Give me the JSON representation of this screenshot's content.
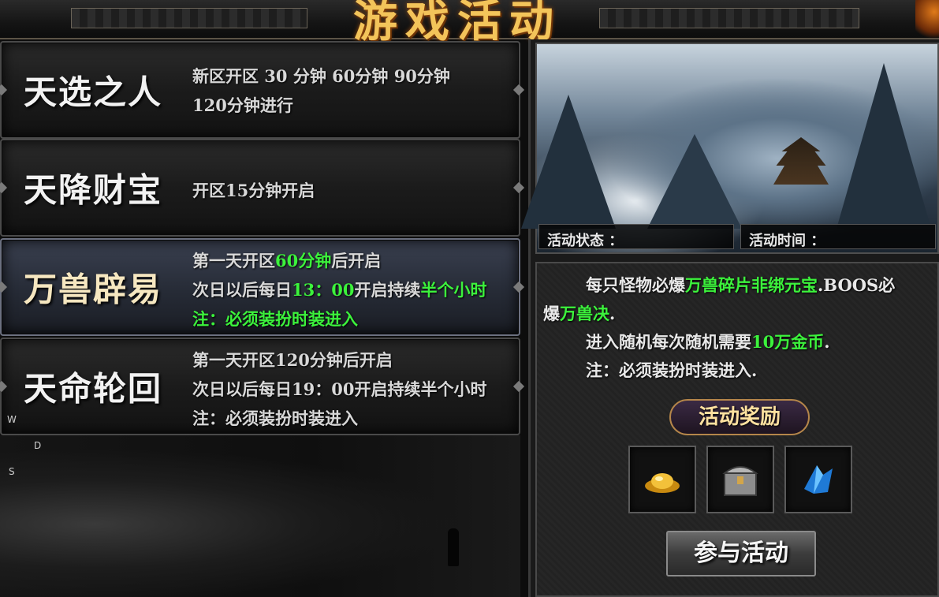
{
  "header": {
    "title": "游戏活动"
  },
  "events": [
    {
      "name": "天选之人",
      "lines": [
        [
          {
            "t": "新区开区 30 分钟    60分钟   90分钟",
            "c": "w"
          }
        ],
        [
          {
            "t": "120分钟进行",
            "c": "w"
          }
        ]
      ]
    },
    {
      "name": "天降财宝",
      "lines": [
        [
          {
            "t": "开区15分钟开启",
            "c": "w"
          }
        ]
      ]
    },
    {
      "name": "万兽辟易",
      "lines": [
        [
          {
            "t": "第一天开区",
            "c": "w"
          },
          {
            "t": "60分钟",
            "c": "g"
          },
          {
            "t": "后开启",
            "c": "w"
          }
        ],
        [
          {
            "t": "次日以后每日",
            "c": "w"
          },
          {
            "t": "13：00",
            "c": "g"
          },
          {
            "t": "开启持续",
            "c": "w"
          },
          {
            "t": "半个小时",
            "c": "g"
          }
        ],
        [
          {
            "t": "注：必须装扮时装进入",
            "c": "g"
          }
        ]
      ]
    },
    {
      "name": "天命轮回",
      "lines": [
        [
          {
            "t": "第一天开区120分钟后开启",
            "c": "w"
          }
        ],
        [
          {
            "t": "次日以后每日19：00开启持续半个小时",
            "c": "w"
          }
        ],
        [
          {
            "t": "注：必须装扮时装进入",
            "c": "w"
          }
        ]
      ]
    }
  ],
  "scene": {
    "status_label": "活动状态 ：",
    "time_label": "活动时间 ："
  },
  "info": {
    "line1a": "每只怪物必爆",
    "line1b": "万兽碎片非绑元宝",
    "line1c": ".BOOS必",
    "line2a": "爆",
    "line2b": "万兽决",
    "line2c": ".",
    "line3a": "进入随机每次随机需要",
    "line3b": "10万金币",
    "line3c": ".",
    "line4": "注：必须装扮时装进入."
  },
  "rewards": {
    "title": "活动奖励",
    "items": [
      "gold-ingot-icon",
      "treasure-chest-icon",
      "blue-crystal-icon"
    ]
  },
  "join_button": "参与活动",
  "keys": [
    "W",
    "D",
    "S"
  ],
  "colors": {
    "highlight": "#3cf23c",
    "title_gold": "#f3c45a"
  }
}
